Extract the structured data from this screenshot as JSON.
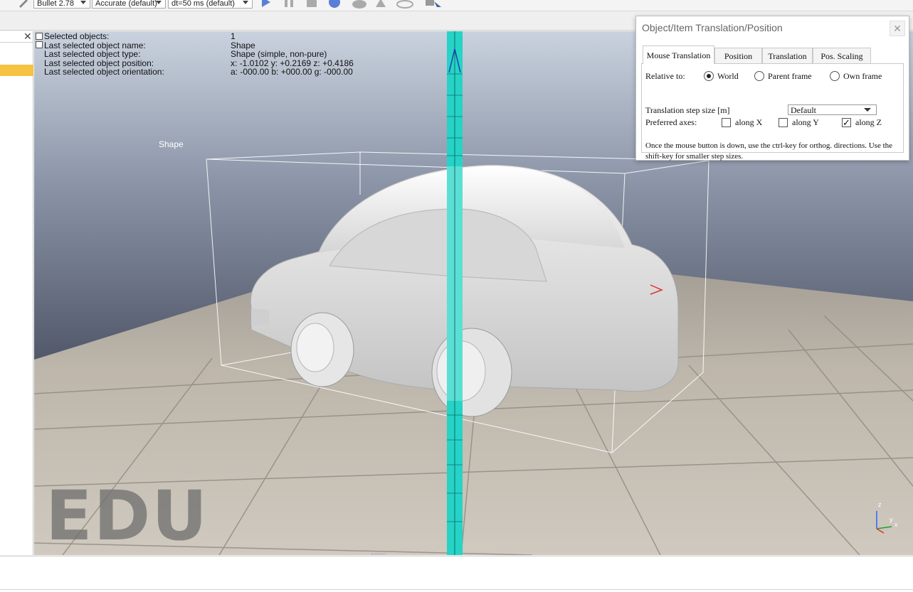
{
  "toolbar": {
    "engine_select": "Bullet 2.78",
    "accuracy_select": "Accurate (default)",
    "timestep_select": "dt=50 ms (default)",
    "icons": [
      "pen-icon",
      "play-icon",
      "pause-icon",
      "stop-icon",
      "realtime-icon",
      "turtle-icon",
      "rabbit-icon",
      "eye-icon",
      "cursor-select-icon"
    ]
  },
  "info_overlay": {
    "labels": [
      "Selected objects:",
      "Last selected object name:",
      "Last selected object type:",
      "Last selected object position:",
      "Last selected object orientation:"
    ],
    "values": [
      "1",
      "Shape",
      "Shape (simple, non-pure)",
      "x: -1.0102   y: +0.2169   z: +0.4186",
      "a: -000.00   b: +000.00   g: -000.00"
    ]
  },
  "scene": {
    "object_label": "Shape",
    "watermark": "EDU",
    "axes_labels": [
      "z",
      "y",
      "x"
    ],
    "colors": {
      "sky_top": "#c6cfdb",
      "sky_bottom": "#5c6478",
      "floor": "#b9b2a7",
      "car": "#e2e2e2",
      "axis_beam": "#22d1c4"
    }
  },
  "dialog": {
    "title": "Object/Item Translation/Position",
    "close_glyph": "✕",
    "tabs": [
      "Mouse Translation",
      "Position",
      "Translation",
      "Pos. Scaling"
    ],
    "active_tab": "Mouse Translation",
    "relative_to_label": "Relative to:",
    "relative_options": [
      "World",
      "Parent frame",
      "Own frame"
    ],
    "relative_selected": "World",
    "step_size_label": "Translation step size [m]",
    "step_size_value": "Default",
    "preferred_axes_label": "Preferred axes:",
    "axes": [
      {
        "label": "along X",
        "checked": false
      },
      {
        "label": "along Y",
        "checked": false
      },
      {
        "label": "along Z",
        "checked": true
      }
    ],
    "check_glyph": "✓",
    "help_line1": "Once the mouse button is down, use the ctrl-key for orthog. directions. Use the",
    "help_line2": "shift-key for smaller step sizes."
  },
  "left_panel": {
    "close_glyph": "✕"
  }
}
